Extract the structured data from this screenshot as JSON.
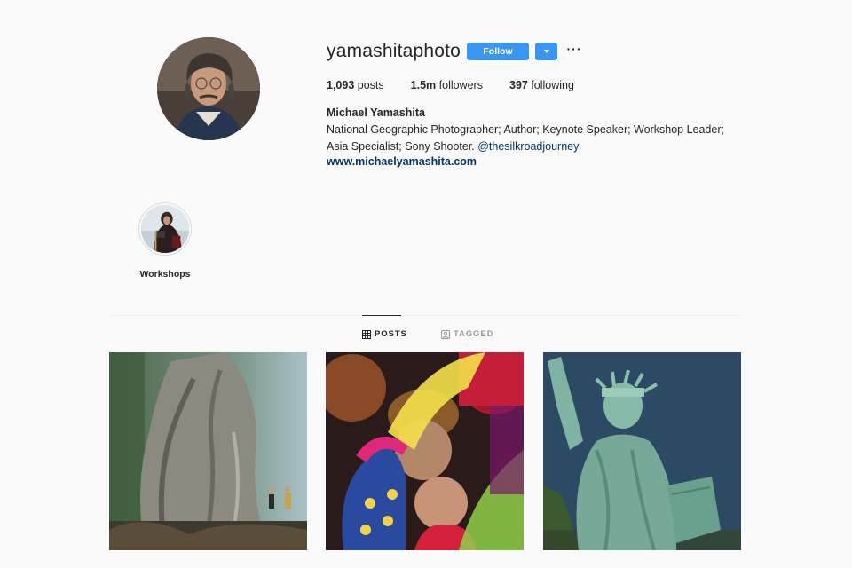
{
  "profile": {
    "username": "yamashitaphoto",
    "follow_label": "Follow",
    "full_name": "Michael Yamashita",
    "bio_text": "National Geographic Photographer; Author; Keynote Speaker; Workshop Leader; Asia Specialist; Sony Shooter. ",
    "bio_mention": "@thesilkroadjourney",
    "website": "www.michaelyamashita.com"
  },
  "stats": {
    "posts_count": "1,093",
    "posts_label": "posts",
    "followers_count": "1.5m",
    "followers_label": "followers",
    "following_count": "397",
    "following_label": "following"
  },
  "highlights": [
    {
      "label": "Workshops"
    }
  ],
  "tabs": {
    "posts_label": "POSTS",
    "tagged_label": "TAGGED",
    "active": "POSTS"
  },
  "icons": {
    "more": "more-options-icon",
    "dropdown": "chevron-down-icon",
    "posts": "grid-icon",
    "tagged": "tag-icon"
  },
  "colors": {
    "accent": "#3897f0",
    "link": "#003569",
    "background": "#fafafa"
  }
}
